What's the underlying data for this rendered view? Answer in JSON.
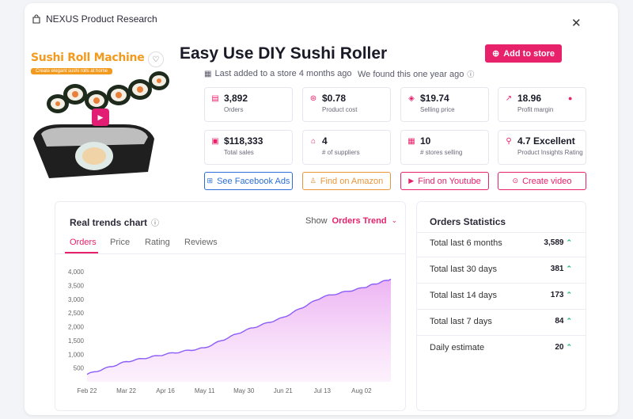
{
  "header": {
    "brand": "NEXUS Product Research",
    "close": "✕"
  },
  "product": {
    "image_title": "Sushi Roll Machine",
    "image_subtitle": "Create elegant sushi rolls at home",
    "title": "Easy Use DIY Sushi Roller",
    "last_added": "Last added to a store 4 months ago",
    "found": "We found this one year ago",
    "add_button": "Add to store"
  },
  "stats": [
    {
      "icon": "orders-icon",
      "glyph": "▤",
      "value": "3,892",
      "label": "Orders"
    },
    {
      "icon": "cost-icon",
      "glyph": "⊛",
      "value": "$0.78",
      "label": "Product cost"
    },
    {
      "icon": "tag-icon",
      "glyph": "◈",
      "value": "$19.74",
      "label": "Selling price"
    },
    {
      "icon": "trend-icon",
      "glyph": "↗",
      "value": "18.96",
      "label": "Profit margin",
      "extra": "🔥"
    },
    {
      "icon": "cart-icon",
      "glyph": "▣",
      "value": "$118,333",
      "label": "Total sales"
    },
    {
      "icon": "home-icon",
      "glyph": "⌂",
      "value": "4",
      "label": "# of suppliers"
    },
    {
      "icon": "store-icon",
      "glyph": "▦",
      "value": "10",
      "label": "# stores selling"
    },
    {
      "icon": "insights-icon",
      "glyph": "⚲",
      "value": "4.7 Excellent",
      "label": "Product Insights Rating"
    }
  ],
  "actions": [
    {
      "label": "See Facebook Ads",
      "glyph": "⊞",
      "color": "#2d6fd6"
    },
    {
      "label": "Find on Amazon",
      "glyph": "♙",
      "color": "#e9963a"
    },
    {
      "label": "Find on Youtube",
      "glyph": "▶",
      "color": "#e8216b"
    },
    {
      "label": "Create video",
      "glyph": "⊙",
      "color": "#e8216b"
    }
  ],
  "chart_panel": {
    "title": "Real trends chart",
    "show_label": "Show",
    "show_value": "Orders Trend",
    "tabs": [
      "Orders",
      "Price",
      "Rating",
      "Reviews"
    ]
  },
  "chart_data": {
    "type": "area",
    "x": [
      "Feb 22",
      "Mar 22",
      "Apr 16",
      "May 11",
      "May 30",
      "Jun 21",
      "Jul 13",
      "Aug 02"
    ],
    "x_tick_labels": [
      "Feb 22",
      "Mar 22",
      "Apr 16",
      "May 11",
      "May 30",
      "Jun 21",
      "Jul 13",
      "Aug 02"
    ],
    "y_tick_labels": [
      "500",
      "1,000",
      "1,500",
      "2,000",
      "2,500",
      "3,000",
      "3,500",
      "4,000"
    ],
    "series": [
      {
        "values": [
          270,
          730,
          1000,
          1230,
          1850,
          2330,
          3080,
          3400,
          3730
        ]
      }
    ],
    "series_x_positions": [
      0,
      1,
      2,
      3,
      4,
      5,
      6,
      7,
      7.75
    ],
    "ylim": [
      0,
      4000
    ],
    "colors": {
      "line": "#8b5cf6",
      "fill_top": "#e9a6f1",
      "fill_bottom": "#fbe8fb"
    }
  },
  "orders_stats": {
    "title": "Orders Statistics",
    "rows": [
      {
        "label": "Total last 6 months",
        "value": "3,589"
      },
      {
        "label": "Total last 30 days",
        "value": "381"
      },
      {
        "label": "Total last 14 days",
        "value": "173"
      },
      {
        "label": "Total last 7 days",
        "value": "84"
      },
      {
        "label": "Daily estimate",
        "value": "20"
      }
    ]
  },
  "colors": {
    "accent": "#e8216b",
    "up": "#18b97a"
  }
}
